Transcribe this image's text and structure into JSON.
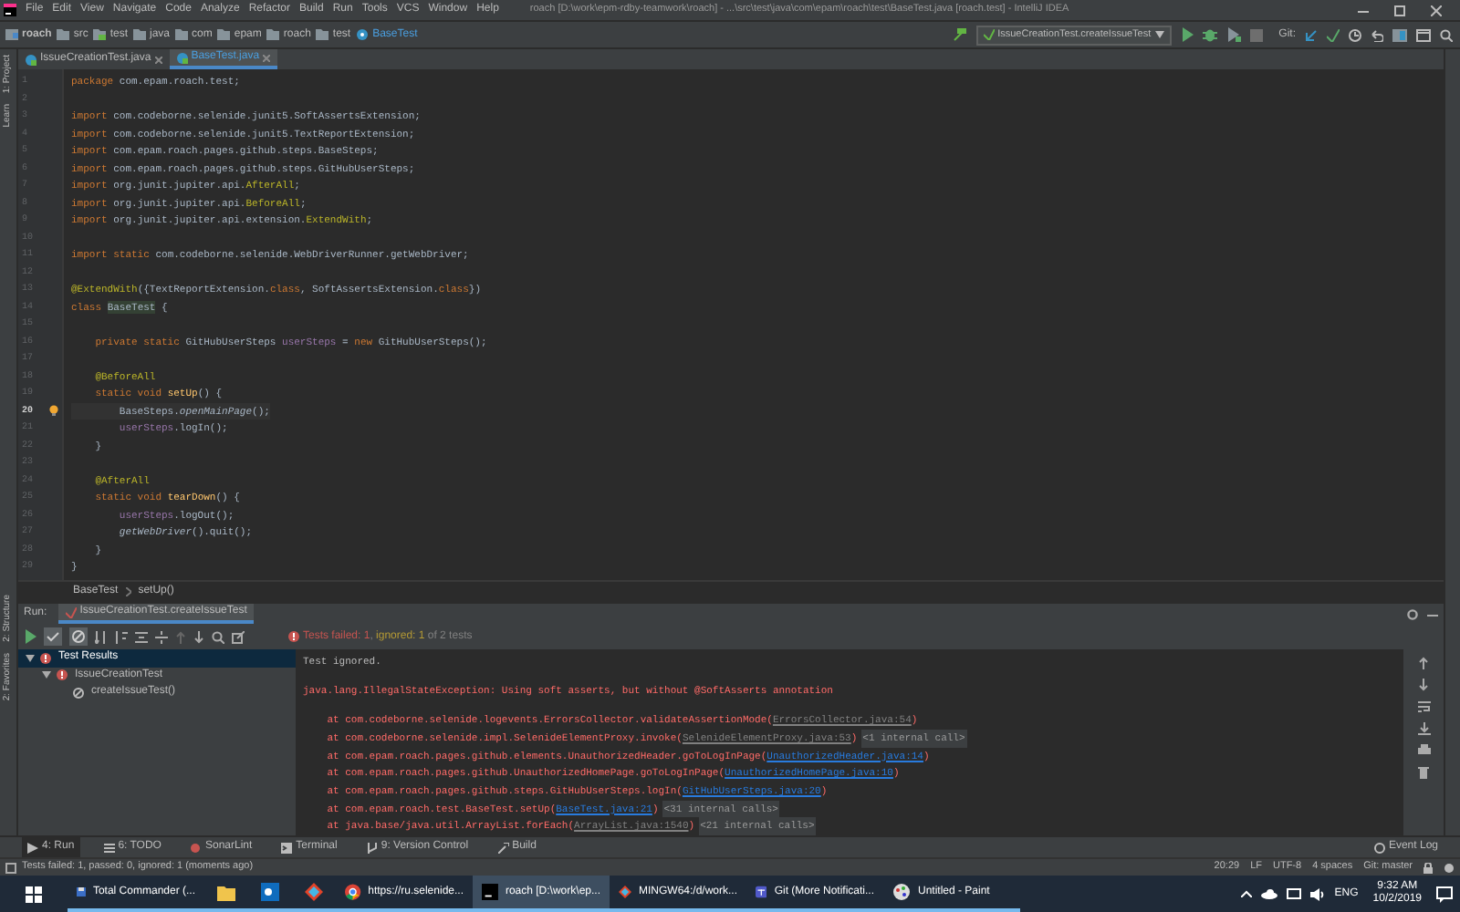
{
  "window": {
    "title": "roach [D:\\work\\epm-rdby-teamwork\\roach] - ...\\src\\test\\java\\com\\epam\\roach\\test\\BaseTest.java [roach.test] - IntelliJ IDEA"
  },
  "menu": [
    "File",
    "Edit",
    "View",
    "Navigate",
    "Code",
    "Analyze",
    "Refactor",
    "Build",
    "Run",
    "Tools",
    "VCS",
    "Window",
    "Help"
  ],
  "navigation": {
    "breadcrumbs": [
      {
        "kind": "module",
        "label": "roach"
      },
      {
        "kind": "folder",
        "label": "src"
      },
      {
        "kind": "source",
        "label": "test"
      },
      {
        "kind": "folder",
        "label": "java"
      },
      {
        "kind": "folder",
        "label": "com"
      },
      {
        "kind": "folder",
        "label": "epam"
      },
      {
        "kind": "folder",
        "label": "roach"
      },
      {
        "kind": "folder",
        "label": "test"
      },
      {
        "kind": "class",
        "label": "BaseTest"
      }
    ],
    "run_config": "IssueCreationTest.createIssueTest",
    "vcs_label": "Git:"
  },
  "left_tools_top": [
    "1: Project",
    "Learn"
  ],
  "left_tools_bottom": [
    "2: Structure",
    "2: Favorites"
  ],
  "editor_tabs": [
    {
      "label": "IssueCreationTest.java",
      "selected": false
    },
    {
      "label": "BaseTest.java",
      "selected": true
    }
  ],
  "code_lines": [
    {
      "number": "1",
      "current": false,
      "tokens": [
        {
          "kind": "kw",
          "text": "package"
        },
        {
          "kind": "plain",
          "text": " com.epam.roach.test;"
        }
      ]
    },
    {
      "number": "2",
      "current": false
    },
    {
      "number": "3",
      "current": false,
      "tokens": [
        {
          "kind": "kw",
          "text": "import"
        },
        {
          "kind": "plain",
          "text": " com.codeborne.selenide.junit5.SoftAssertsExtension;"
        }
      ]
    },
    {
      "number": "4",
      "current": false,
      "tokens": [
        {
          "kind": "kw",
          "text": "import"
        },
        {
          "kind": "plain",
          "text": " com.codeborne.selenide.junit5.TextReportExtension;"
        }
      ]
    },
    {
      "number": "5",
      "current": false,
      "tokens": [
        {
          "kind": "kw",
          "text": "import"
        },
        {
          "kind": "plain",
          "text": " com.epam.roach.pages.github.steps.BaseSteps;"
        }
      ]
    },
    {
      "number": "6",
      "current": false,
      "tokens": [
        {
          "kind": "kw",
          "text": "import"
        },
        {
          "kind": "plain",
          "text": " com.epam.roach.pages.github.steps.GitHubUserSteps;"
        }
      ]
    },
    {
      "number": "7",
      "current": false,
      "tokens": [
        {
          "kind": "kw",
          "text": "import"
        },
        {
          "kind": "plain",
          "text": " org.junit.jupiter.api."
        },
        {
          "kind": "ann",
          "text": "AfterAll"
        },
        {
          "kind": "plain",
          "text": ";"
        }
      ]
    },
    {
      "number": "8",
      "current": false,
      "tokens": [
        {
          "kind": "kw",
          "text": "import"
        },
        {
          "kind": "plain",
          "text": " org.junit.jupiter.api."
        },
        {
          "kind": "ann",
          "text": "BeforeAll"
        },
        {
          "kind": "plain",
          "text": ";"
        }
      ]
    },
    {
      "number": "9",
      "current": false,
      "tokens": [
        {
          "kind": "kw",
          "text": "import"
        },
        {
          "kind": "plain",
          "text": " org.junit.jupiter.api.extension."
        },
        {
          "kind": "ann",
          "text": "ExtendWith"
        },
        {
          "kind": "plain",
          "text": ";"
        }
      ]
    },
    {
      "number": "10",
      "current": false
    },
    {
      "number": "11",
      "current": false,
      "tokens": [
        {
          "kind": "kw",
          "text": "import static"
        },
        {
          "kind": "plain",
          "text": " com.codeborne.selenide.WebDriverRunner.getWebDriver;"
        }
      ]
    },
    {
      "number": "12",
      "current": false
    },
    {
      "number": "13",
      "current": false,
      "tokens": [
        {
          "kind": "ann",
          "text": "@ExtendWith"
        },
        {
          "kind": "plain",
          "text": "({TextReportExtension."
        },
        {
          "kind": "kw",
          "text": "class"
        },
        {
          "kind": "plain",
          "text": ", SoftAssertsExtension."
        },
        {
          "kind": "kw",
          "text": "class"
        },
        {
          "kind": "plain",
          "text": "})"
        }
      ]
    },
    {
      "number": "14",
      "current": false,
      "tokens": [
        {
          "kind": "kw",
          "text": "class "
        },
        {
          "kind": "highlight",
          "text": "BaseTest"
        },
        {
          "kind": "plain",
          "text": " {"
        }
      ]
    },
    {
      "number": "15",
      "current": false
    },
    {
      "number": "16",
      "current": false,
      "tokens": [
        {
          "kind": "kw",
          "text": "    private static "
        },
        {
          "kind": "plain",
          "text": "GitHubUserSteps "
        },
        {
          "kind": "field",
          "text": "userSteps"
        },
        {
          "kind": "plain",
          "text": " = "
        },
        {
          "kind": "kw",
          "text": "new "
        },
        {
          "kind": "plain",
          "text": "GitHubUserSteps();"
        }
      ]
    },
    {
      "number": "17",
      "current": false
    },
    {
      "number": "18",
      "current": false,
      "tokens": [
        {
          "kind": "ann",
          "text": "    @BeforeAll"
        }
      ]
    },
    {
      "number": "19",
      "current": false,
      "tokens": [
        {
          "kind": "kw",
          "text": "    static void "
        },
        {
          "kind": "fn",
          "text": "setUp"
        },
        {
          "kind": "plain",
          "text": "() {"
        }
      ]
    },
    {
      "number": "20",
      "current": true,
      "tokens": [
        {
          "kind": "plain",
          "text": "        BaseSteps."
        },
        {
          "kind": "static",
          "text": "openMainPage"
        },
        {
          "kind": "plain",
          "text": "();"
        }
      ]
    },
    {
      "number": "21",
      "current": false,
      "tokens": [
        {
          "kind": "field",
          "text": "        userSteps"
        },
        {
          "kind": "plain",
          "text": ".logIn();"
        }
      ]
    },
    {
      "number": "22",
      "current": false,
      "tokens": [
        {
          "kind": "plain",
          "text": "    }"
        }
      ]
    },
    {
      "number": "23",
      "current": false
    },
    {
      "number": "24",
      "current": false,
      "tokens": [
        {
          "kind": "ann",
          "text": "    @AfterAll"
        }
      ]
    },
    {
      "number": "25",
      "current": false,
      "tokens": [
        {
          "kind": "kw",
          "text": "    static void "
        },
        {
          "kind": "fn",
          "text": "tearDown"
        },
        {
          "kind": "plain",
          "text": "() {"
        }
      ]
    },
    {
      "number": "26",
      "current": false,
      "tokens": [
        {
          "kind": "field",
          "text": "        userSteps"
        },
        {
          "kind": "plain",
          "text": ".logOut();"
        }
      ]
    },
    {
      "number": "27",
      "current": false,
      "tokens": [
        {
          "kind": "static",
          "text": "        getWebDriver"
        },
        {
          "kind": "plain",
          "text": "().quit();"
        }
      ]
    },
    {
      "number": "28",
      "current": false,
      "tokens": [
        {
          "kind": "plain",
          "text": "    }"
        }
      ]
    },
    {
      "number": "29",
      "current": false,
      "tokens": [
        {
          "kind": "plain",
          "text": "}"
        }
      ]
    }
  ],
  "editor_breadcrumbs": [
    "BaseTest",
    "setUp()"
  ],
  "run": {
    "title": "Run:",
    "tab": "IssueCreationTest.createIssueTest",
    "summary": [
      {
        "kind": "failed",
        "text": "Tests failed: 1"
      },
      {
        "kind": "plain",
        "text": ", "
      },
      {
        "kind": "ignored",
        "text": "ignored: 1"
      },
      {
        "kind": "plain",
        "text": " of 2 tests"
      }
    ],
    "tree": [
      {
        "label": "Test Results",
        "kind": "failed",
        "selected": true,
        "children": [
          {
            "label": "IssueCreationTest",
            "kind": "failed",
            "selected": false,
            "children": [
              {
                "label": "createIssueTest()",
                "kind": "ignored",
                "selected": false
              }
            ]
          }
        ]
      }
    ],
    "console": [
      [
        {
          "kind": "text",
          "text": "Test ignored."
        }
      ],
      [
        {
          "kind": "blank"
        }
      ],
      [
        {
          "kind": "error",
          "text": "java.lang.IllegalStateException: Using soft asserts, but without @SoftAsserts annotation"
        }
      ],
      [
        {
          "kind": "blank"
        }
      ],
      [
        {
          "kind": "error",
          "text": "    at com.codeborne.selenide.logevents.ErrorsCollector.validateAssertionMode("
        },
        {
          "kind": "lib_link",
          "text": "ErrorsCollector.java:54"
        },
        {
          "kind": "error",
          "text": ")"
        }
      ],
      [
        {
          "kind": "error",
          "text": "    at com.codeborne.selenide.impl.SelenideElementProxy.invoke("
        },
        {
          "kind": "lib_link",
          "text": "SelenideElementProxy.java:53"
        },
        {
          "kind": "error",
          "text": ")"
        },
        {
          "kind": "fold",
          "text": "<1 internal call>"
        }
      ],
      [
        {
          "kind": "error",
          "text": "    at com.epam.roach.pages.github.elements.UnauthorizedHeader.goToLogInPage("
        },
        {
          "kind": "link",
          "text": "UnauthorizedHeader.java:14"
        },
        {
          "kind": "error",
          "text": ")"
        }
      ],
      [
        {
          "kind": "error",
          "text": "    at com.epam.roach.pages.github.UnauthorizedHomePage.goToLogInPage("
        },
        {
          "kind": "link",
          "text": "UnauthorizedHomePage.java:10"
        },
        {
          "kind": "error",
          "text": ")"
        }
      ],
      [
        {
          "kind": "error",
          "text": "    at com.epam.roach.pages.github.steps.GitHubUserSteps.logIn("
        },
        {
          "kind": "link",
          "text": "GitHubUserSteps.java:20"
        },
        {
          "kind": "error",
          "text": ")"
        }
      ],
      [
        {
          "kind": "error",
          "text": "    at com.epam.roach.test.BaseTest.setUp("
        },
        {
          "kind": "link",
          "text": "BaseTest.java:21"
        },
        {
          "kind": "error",
          "text": ")"
        },
        {
          "kind": "fold",
          "text": "<31 internal calls>"
        }
      ],
      [
        {
          "kind": "error",
          "text": "    at java.base/java.util.ArrayList.forEach("
        },
        {
          "kind": "lib_link",
          "text": "ArrayList.java:1540"
        },
        {
          "kind": "error",
          "text": ")"
        },
        {
          "kind": "fold",
          "text": "<21 internal calls>"
        }
      ]
    ]
  },
  "tool_windows": [
    {
      "kind": "run",
      "label": "4: Run",
      "selected": true
    },
    {
      "kind": "todo",
      "label": "6: TODO",
      "selected": false
    },
    {
      "kind": "sonar",
      "label": "SonarLint",
      "selected": false
    },
    {
      "kind": "terminal",
      "label": "Terminal",
      "selected": false
    },
    {
      "kind": "vcs",
      "label": "9: Version Control",
      "selected": false
    },
    {
      "kind": "build",
      "label": "Build",
      "selected": false
    }
  ],
  "event_log": "Event Log",
  "status_bar": {
    "message": "Tests failed: 1, passed: 0, ignored: 1 (moments ago)",
    "items": [
      "20:29",
      "LF",
      "UTF-8",
      "4 spaces",
      "Git: master"
    ]
  },
  "taskbar": {
    "items": [
      {
        "kind": "tc",
        "label": "Total Commander (...",
        "selected": false
      },
      {
        "kind": "explorer",
        "selected": false
      },
      {
        "kind": "outlook",
        "selected": false
      },
      {
        "kind": "git",
        "selected": false
      },
      {
        "kind": "chrome",
        "label": "https://ru.selenide...",
        "selected": false
      },
      {
        "kind": "idea",
        "label": "roach [D:\\work\\ep...",
        "selected": true
      },
      {
        "kind": "mingw",
        "label": "MINGW64:/d/work...",
        "selected": false
      },
      {
        "kind": "teams",
        "label": "Git (More Notificati...",
        "selected": false
      },
      {
        "kind": "paint",
        "label": "Untitled - Paint",
        "selected": false
      }
    ],
    "language": "ENG",
    "time": "9:32 AM",
    "date": "10/2/2019"
  }
}
